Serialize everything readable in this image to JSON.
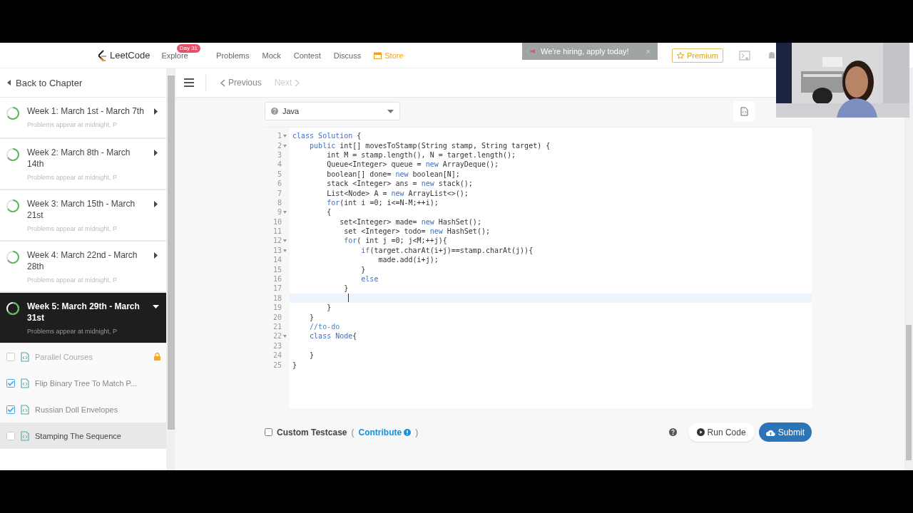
{
  "nav": {
    "logo": "LeetCode",
    "links": [
      {
        "label": "Explore",
        "badge": "Day 31",
        "kind": "plain"
      },
      {
        "label": "Problems",
        "kind": "plain"
      },
      {
        "label": "Mock",
        "kind": "plain"
      },
      {
        "label": "Contest",
        "kind": "plain"
      },
      {
        "label": "Discuss",
        "kind": "plain"
      },
      {
        "label": "Store",
        "kind": "store"
      }
    ],
    "banner": "We're hiring, apply today!",
    "banner_close": "×",
    "premium": "Premium"
  },
  "sidebar": {
    "back": "Back to Chapter",
    "weeks": [
      {
        "title": "Week 1: March 1st - March 7th",
        "subtitle": "Problems appear at midnight, P",
        "selected": false,
        "expanded": false
      },
      {
        "title": "Week 2: March 8th - March 14th",
        "subtitle": "Problems appear at midnight, P",
        "selected": false,
        "expanded": false
      },
      {
        "title": "Week 3: March 15th - March 21st",
        "subtitle": "Problems appear at midnight, P",
        "selected": false,
        "expanded": false
      },
      {
        "title": "Week 4: March 22nd - March 28th",
        "subtitle": "Problems appear at midnight, P",
        "selected": false,
        "expanded": false
      },
      {
        "title": "Week 5: March 29th - March 31st",
        "subtitle": "Problems appear at midnight, P",
        "selected": true,
        "expanded": true
      }
    ],
    "problems": [
      {
        "title": "Parallel Courses",
        "checked": false,
        "locked": true,
        "selected": false
      },
      {
        "title": "Flip Binary Tree To Match P...",
        "checked": true,
        "locked": false,
        "selected": false
      },
      {
        "title": "Russian Doll Envelopes",
        "checked": true,
        "locked": false,
        "selected": false
      },
      {
        "title": "Stamping The Sequence",
        "checked": false,
        "locked": false,
        "selected": true
      }
    ]
  },
  "toolbar": {
    "previous": {
      "label": "Previous",
      "disabled": false
    },
    "next": {
      "label": "Next",
      "disabled": true
    }
  },
  "language": "Java",
  "editor": {
    "lines": [
      {
        "number": "1",
        "fold": true,
        "current": false,
        "tokens": [
          {
            "kind": "kw",
            "text": "class Solution"
          },
          {
            "kind": "plain",
            "text": " {"
          }
        ]
      },
      {
        "number": "2",
        "fold": true,
        "current": false,
        "tokens": [
          {
            "kind": "kw",
            "text": "    public"
          },
          {
            "kind": "plain",
            "text": " int[] movesToStamp(String stamp, String target) {"
          }
        ]
      },
      {
        "number": "3",
        "fold": false,
        "current": false,
        "tokens": [
          {
            "kind": "plain",
            "text": "        int M = stamp.length(), N = target.length();"
          }
        ]
      },
      {
        "number": "4",
        "fold": false,
        "current": false,
        "tokens": [
          {
            "kind": "plain",
            "text": "        Queue<Integer> queue = "
          },
          {
            "kind": "kw",
            "text": "new"
          },
          {
            "kind": "plain",
            "text": " ArrayDeque();"
          }
        ]
      },
      {
        "number": "5",
        "fold": false,
        "current": false,
        "tokens": [
          {
            "kind": "plain",
            "text": "        boolean[] done= "
          },
          {
            "kind": "kw",
            "text": "new"
          },
          {
            "kind": "plain",
            "text": " boolean[N];"
          }
        ]
      },
      {
        "number": "6",
        "fold": false,
        "current": false,
        "tokens": [
          {
            "kind": "plain",
            "text": "        stack <Integer> ans = "
          },
          {
            "kind": "kw",
            "text": "new"
          },
          {
            "kind": "plain",
            "text": " stack();"
          }
        ]
      },
      {
        "number": "7",
        "fold": false,
        "current": false,
        "tokens": [
          {
            "kind": "plain",
            "text": "        List<Node> A = "
          },
          {
            "kind": "kw",
            "text": "new"
          },
          {
            "kind": "plain",
            "text": " ArrayList<>();"
          }
        ]
      },
      {
        "number": "8",
        "fold": false,
        "current": false,
        "tokens": [
          {
            "kind": "kw",
            "text": "        for"
          },
          {
            "kind": "plain",
            "text": "(int i =0; i<=N-M;++i);"
          }
        ]
      },
      {
        "number": "9",
        "fold": true,
        "current": false,
        "tokens": [
          {
            "kind": "plain",
            "text": "        {"
          }
        ]
      },
      {
        "number": "10",
        "fold": false,
        "current": false,
        "tokens": [
          {
            "kind": "plain",
            "text": "           set<Integer> made= "
          },
          {
            "kind": "kw",
            "text": "new"
          },
          {
            "kind": "plain",
            "text": " HashSet();"
          }
        ]
      },
      {
        "number": "11",
        "fold": false,
        "current": false,
        "tokens": [
          {
            "kind": "plain",
            "text": "            set <Integer> todo= "
          },
          {
            "kind": "kw",
            "text": "new"
          },
          {
            "kind": "plain",
            "text": " HashSet();"
          }
        ]
      },
      {
        "number": "12",
        "fold": true,
        "current": false,
        "tokens": [
          {
            "kind": "kw",
            "text": "            for"
          },
          {
            "kind": "plain",
            "text": "( int j =0; j<M;++j){"
          }
        ]
      },
      {
        "number": "13",
        "fold": true,
        "current": false,
        "tokens": [
          {
            "kind": "kw",
            "text": "                if"
          },
          {
            "kind": "plain",
            "text": "(target.charAt(i+j)==stamp.charAt(j)){"
          }
        ]
      },
      {
        "number": "14",
        "fold": false,
        "current": false,
        "tokens": [
          {
            "kind": "plain",
            "text": "                    made.add(i+j);"
          }
        ]
      },
      {
        "number": "15",
        "fold": false,
        "current": false,
        "tokens": [
          {
            "kind": "plain",
            "text": "                }"
          }
        ]
      },
      {
        "number": "16",
        "fold": false,
        "current": false,
        "tokens": [
          {
            "kind": "kw",
            "text": "                else"
          }
        ]
      },
      {
        "number": "17",
        "fold": false,
        "current": false,
        "tokens": [
          {
            "kind": "plain",
            "text": "            }"
          }
        ]
      },
      {
        "number": "18",
        "fold": false,
        "current": true
      },
      {
        "number": "19",
        "fold": false,
        "current": false,
        "tokens": [
          {
            "kind": "plain",
            "text": "        }"
          }
        ]
      },
      {
        "number": "20",
        "fold": false,
        "current": false,
        "tokens": [
          {
            "kind": "plain",
            "text": "    }"
          }
        ]
      },
      {
        "number": "21",
        "fold": false,
        "current": false,
        "tokens": [
          {
            "kind": "comment",
            "text": "    //to-do"
          }
        ]
      },
      {
        "number": "22",
        "fold": true,
        "current": false,
        "tokens": [
          {
            "kind": "kw",
            "text": "    class Node"
          },
          {
            "kind": "plain",
            "text": "{"
          }
        ]
      },
      {
        "number": "23",
        "fold": false,
        "current": false
      },
      {
        "number": "24",
        "fold": false,
        "current": false,
        "tokens": [
          {
            "kind": "plain",
            "text": "    }"
          }
        ]
      },
      {
        "number": "25",
        "fold": false,
        "current": false,
        "tokens": [
          {
            "kind": "plain",
            "text": "}"
          }
        ]
      }
    ]
  },
  "footer": {
    "custom_testcase": {
      "label": "Custom Testcase",
      "checked": false
    },
    "paren_open": "(",
    "contribute": "Contribute",
    "paren_close": ")",
    "run": "Run Code",
    "submit": "Submit"
  }
}
